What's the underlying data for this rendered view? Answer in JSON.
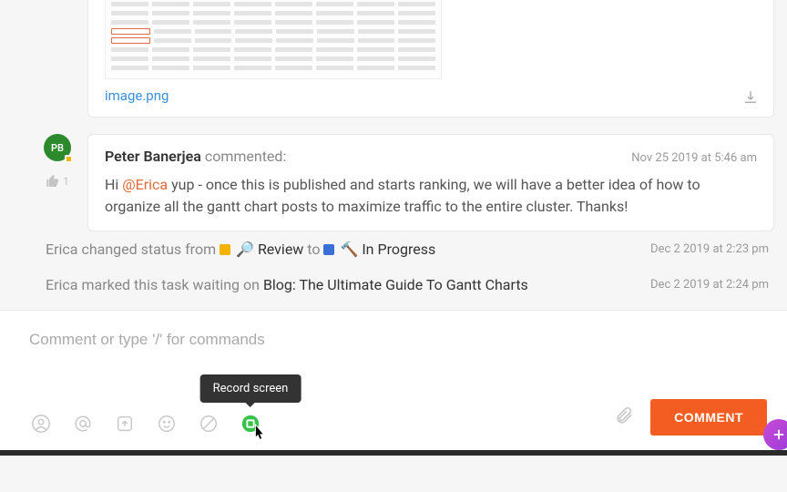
{
  "attachment": {
    "filename": "image.png"
  },
  "comment": {
    "avatar_initials": "PB",
    "author": "Peter Banerjea",
    "action": "commented:",
    "timestamp": "Nov 25 2019 at 5:46 am",
    "like_count": "1",
    "body_prefix": "Hi ",
    "mention": "@Erica",
    "body_suffix": " yup - once this is published and starts ranking, we will have a better idea of how to organize all the gantt chart posts to maximize traffic to the entire cluster. Thanks!"
  },
  "activity1": {
    "prefix": "Erica changed status from ",
    "from_icon": "🔎",
    "from_label": "Review",
    "mid": " to ",
    "to_icon": "🔨",
    "to_label": "In Progress",
    "timestamp": "Dec 2 2019 at 2:23 pm"
  },
  "activity2": {
    "prefix": "Erica marked this task waiting on ",
    "task_link": "Blog: The Ultimate Guide To Gantt Charts",
    "timestamp": "Dec 2 2019 at 2:24 pm"
  },
  "composer": {
    "placeholder": "Comment or type '/' for commands",
    "tooltip": "Record screen",
    "submit_label": "COMMENT"
  }
}
